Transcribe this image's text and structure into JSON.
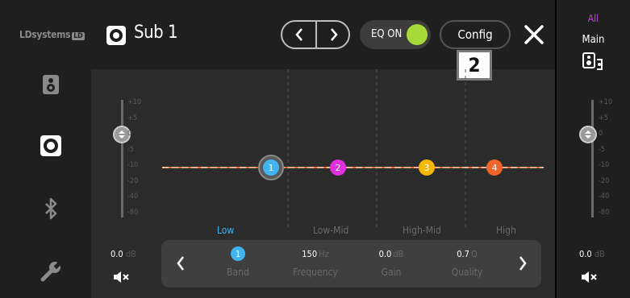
{
  "brand": {
    "name": "LDsystems",
    "logo_mark": "LD"
  },
  "header": {
    "title": "Sub 1",
    "prev_icon": "chevron-left-icon",
    "next_icon": "chevron-right-icon",
    "eq_label": "EQ ON",
    "eq_enabled": true,
    "config_label": "Config",
    "close_icon": "close-icon",
    "step_badge": "2"
  },
  "left_nav": [
    {
      "name": "speaker-icon",
      "active": false
    },
    {
      "name": "subwoofer-icon",
      "active": true
    },
    {
      "name": "bluetooth-icon",
      "active": false
    },
    {
      "name": "wrench-icon",
      "active": false
    }
  ],
  "fader_scale": [
    "+10",
    "+5",
    "0",
    "-5",
    "-10",
    "-20",
    "-40",
    "-80"
  ],
  "channel": {
    "level_value": "0.0",
    "level_unit": "dB",
    "level_db": 0,
    "mute_icon": "mute-icon"
  },
  "eq": {
    "gain_range_db": [
      -10,
      10
    ],
    "bands": [
      {
        "number": "1",
        "color": "#3fb4f0",
        "gain_db": 0,
        "active": true
      },
      {
        "number": "2",
        "color": "#e02fe0",
        "gain_db": 0,
        "active": false
      },
      {
        "number": "3",
        "color": "#f5b800",
        "gain_db": 0,
        "active": false
      },
      {
        "number": "4",
        "color": "#f0642a",
        "gain_db": 0,
        "active": false
      }
    ],
    "band_labels": [
      "Low",
      "Low-Mid",
      "High-Mid",
      "High"
    ],
    "active_band_label": "Low"
  },
  "params": {
    "band": {
      "value": "1",
      "name": "Band"
    },
    "frequency": {
      "value": "150",
      "unit": "Hz",
      "name": "Frequency"
    },
    "gain": {
      "value": "0.0",
      "unit": "dB",
      "name": "Gain"
    },
    "quality": {
      "value": "0.7",
      "unit": "Q",
      "name": "Quality"
    }
  },
  "right_panel": {
    "group_label": "All",
    "title": "Main",
    "icon": "speaker-group-icon",
    "level_value": "0.0",
    "level_unit": "dB",
    "level_db": 0,
    "mute_icon": "mute-icon"
  },
  "colors": {
    "active_blue": "#3fb4f0",
    "eq_on_green": "#a6d93a",
    "all_purple": "#c246e0"
  }
}
